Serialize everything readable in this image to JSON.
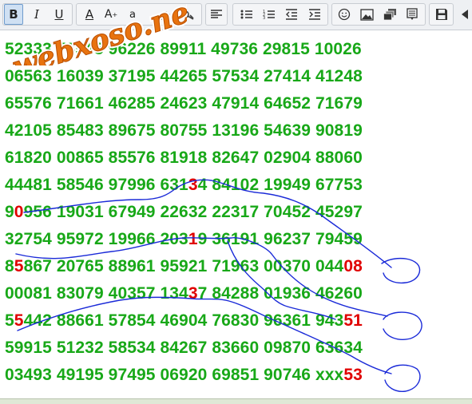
{
  "toolbar": {
    "bold": "B",
    "italic": "I",
    "underline": "U",
    "font_color": "A",
    "font_size": "A",
    "font_size_sub": "a"
  },
  "watermark": "webxoso.net",
  "rows": [
    {
      "segments": [
        {
          "t": "52333 78545 96226 89911 49736 29815 10026",
          "h": false
        }
      ]
    },
    {
      "segments": [
        {
          "t": "06563 16039 37195 44265 57534 27414 41248",
          "h": false
        }
      ]
    },
    {
      "segments": [
        {
          "t": "65576 71661 46285 24623 47914 64652 71679",
          "h": false
        }
      ]
    },
    {
      "segments": [
        {
          "t": "42105 85483 89675 80755 13196 54639 90819",
          "h": false
        }
      ]
    },
    {
      "segments": [
        {
          "t": "61820 00865 85576 81918 82647 02904 88060",
          "h": false
        }
      ]
    },
    {
      "segments": [
        {
          "t": "44481 58546 97996 631",
          "h": false
        },
        {
          "t": "3",
          "h": true
        },
        {
          "t": "4 84102 19949 67753",
          "h": false
        }
      ]
    },
    {
      "segments": [
        {
          "t": "9",
          "h": false
        },
        {
          "t": "0",
          "h": true
        },
        {
          "t": "956 19031 67949 22632 22317 70452 45297",
          "h": false
        }
      ]
    },
    {
      "segments": [
        {
          "t": "32754 95972 19966 203",
          "h": false
        },
        {
          "t": "1",
          "h": true
        },
        {
          "t": "9 36191 96237 79459",
          "h": false
        }
      ]
    },
    {
      "segments": [
        {
          "t": "8",
          "h": false
        },
        {
          "t": "5",
          "h": true
        },
        {
          "t": "867 20765 88961 95921 71963 00370 044",
          "h": false
        },
        {
          "t": "08",
          "h": true
        }
      ]
    },
    {
      "segments": [
        {
          "t": "00081 83079 40357 134",
          "h": false
        },
        {
          "t": "3",
          "h": true
        },
        {
          "t": "7 84288 01936 46260",
          "h": false
        }
      ]
    },
    {
      "segments": [
        {
          "t": "5",
          "h": false
        },
        {
          "t": "5",
          "h": true
        },
        {
          "t": "442 88661 57854 46904 76830 96361 943",
          "h": false
        },
        {
          "t": "51",
          "h": true
        }
      ]
    },
    {
      "segments": [
        {
          "t": "59915 51232 58534 84267 83660 09870 63634",
          "h": false
        }
      ]
    },
    {
      "segments": [
        {
          "t": "03493 49195 97495 06920 69851 90746 xxx",
          "h": false
        },
        {
          "t": "53",
          "h": true
        }
      ]
    }
  ]
}
